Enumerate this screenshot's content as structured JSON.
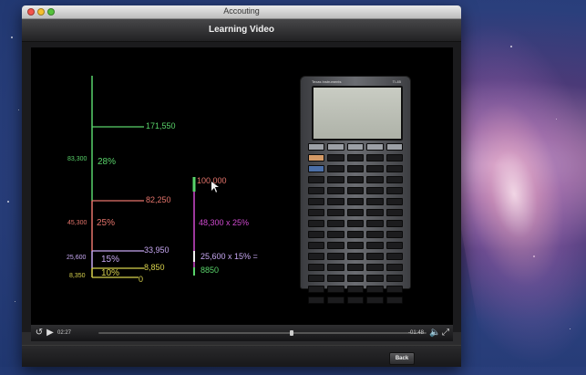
{
  "window": {
    "title": "Accouting"
  },
  "header": {
    "title": "Learning Video"
  },
  "video": {
    "chart": {
      "left_labels": [
        "83,300",
        "45,300",
        "25,600",
        "8,350"
      ],
      "percent_labels": [
        "28%",
        "25%",
        "15%",
        "10%"
      ],
      "right_values": [
        "171,550",
        "82,250",
        "33,950",
        "8,850",
        "0"
      ],
      "annotation_top": "100,000",
      "annotation_mid": "48,300 x 25%",
      "annotation_low": "25,600 x 15% =",
      "annotation_bottom": "8850"
    },
    "calculator": {
      "brand": "Texas Instruments",
      "model": "TI-85"
    }
  },
  "controls": {
    "elapsed": "02:27",
    "remaining": "-01:48"
  },
  "bottom": {
    "back_label": "Back"
  },
  "colors": {
    "green": "#59d36a",
    "red": "#e5746b",
    "magenta": "#d04ad0",
    "lavender": "#c6a7f1",
    "yellow": "#d8d24d",
    "white": "#f0f0f0"
  }
}
